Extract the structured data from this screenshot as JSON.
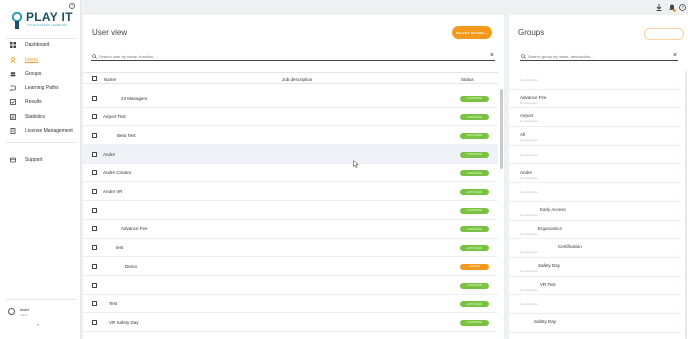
{
  "app": {
    "logo_title": "PLAY IT",
    "logo_sub": "YOUR EXPERT LEARNING",
    "colors": {
      "accent": "#f39a1e",
      "active_green": "#7cc242",
      "brand": "#1f4f63"
    }
  },
  "sidebar": {
    "items": [
      {
        "label": "Dashboard",
        "icon": "grid-icon"
      },
      {
        "label": "Users",
        "icon": "user-icon",
        "active": true
      },
      {
        "label": "Groups",
        "icon": "group-icon"
      },
      {
        "label": "Learning Paths",
        "icon": "path-icon"
      },
      {
        "label": "Results",
        "icon": "results-icon"
      },
      {
        "label": "Statistics",
        "icon": "stats-icon"
      },
      {
        "label": "License Management",
        "icon": "license-icon"
      }
    ],
    "support_label": "Support",
    "user": {
      "name": "Andre",
      "role": "Admin"
    },
    "collapse_label": "«"
  },
  "users_panel": {
    "title": "User view",
    "action_button": "SELECT ACTION",
    "search_placeholder": "Search user by name, function,...",
    "columns": {
      "name": "Name",
      "job": "Job description",
      "status": "Status"
    },
    "rows": [
      {
        "name": "23 Managers",
        "status": "ACTIVATED",
        "status_color": "green"
      },
      {
        "name": "Airport Test",
        "status": "ACTIVATED",
        "status_color": "green"
      },
      {
        "name": "Beta Test",
        "status": "ACTIVATED",
        "status_color": "green"
      },
      {
        "name": "Andre",
        "status": "ACTIVATED",
        "status_color": "green"
      },
      {
        "name": "Andre Creator",
        "status": "ACTIVATED",
        "status_color": "green"
      },
      {
        "name": "Andre VR",
        "status": "ACTIVATED",
        "status_color": "green"
      },
      {
        "name": "",
        "status": "ACTIVATED",
        "status_color": "green"
      },
      {
        "name": "Advance Fire",
        "status": "ACTIVATED",
        "status_color": "green"
      },
      {
        "name": "test",
        "status": "ACTIVATED",
        "status_color": "green"
      },
      {
        "name": "Demo",
        "status": "INVITED",
        "status_color": "orange"
      },
      {
        "name": "",
        "status": "ACTIVATED",
        "status_color": "green"
      },
      {
        "name": "Test",
        "status": "ACTIVATED",
        "status_color": "green"
      },
      {
        "name": "VR Safety Day",
        "status": "ACTIVATED",
        "status_color": "green"
      }
    ]
  },
  "groups_panel": {
    "title": "Groups",
    "search_placeholder": "Search group by name, description,...",
    "rows": [
      {
        "name": "",
        "sub": "No description"
      },
      {
        "name": "Advance Fire",
        "sub": "No description"
      },
      {
        "name": "Airport",
        "sub": "No description"
      },
      {
        "name": "All",
        "sub": "No description"
      },
      {
        "name": "",
        "sub": "No description"
      },
      {
        "name": "Andre",
        "sub": "No description"
      },
      {
        "name": "",
        "sub": "No description"
      },
      {
        "name": "Early Access",
        "sub": "No description"
      },
      {
        "name": "Ergonomics",
        "sub": "No description"
      },
      {
        "name": "Certification",
        "sub": "No description"
      },
      {
        "name": "Safety Day",
        "sub": "No description"
      },
      {
        "name": "VR Test",
        "sub": "No description"
      },
      {
        "name": "",
        "sub": "No description"
      },
      {
        "name": "Safety Day",
        "sub": ""
      }
    ]
  }
}
